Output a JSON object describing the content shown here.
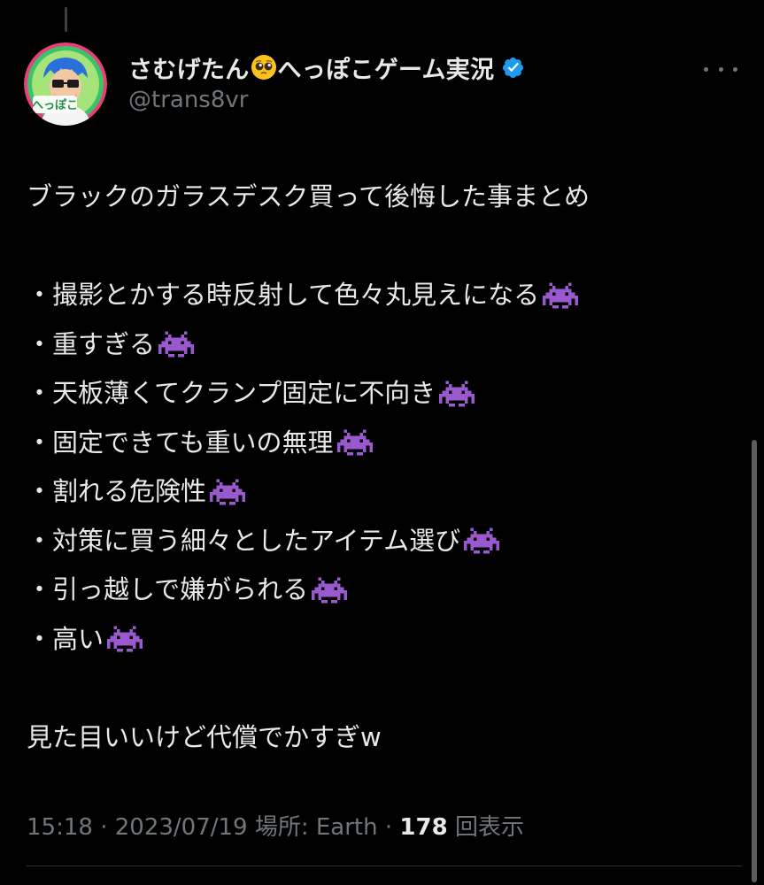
{
  "tweet": {
    "author": {
      "display_name_before_emoji": "さむげたん",
      "display_name_after_emoji": "へっぽこゲーム実況",
      "name_emoji": "pleading-face-emoji",
      "handle": "@trans8vr",
      "verified": true,
      "avatar_text": "へっぽこ"
    },
    "lines": [
      {
        "text": "ブラックのガラスデスク買って後悔した事まとめ",
        "alien": false
      },
      {
        "text": "",
        "alien": false
      },
      {
        "text": "・撮影とかする時反射して色々丸見えになる",
        "alien": true
      },
      {
        "text": "・重すぎる",
        "alien": true
      },
      {
        "text": "・天板薄くてクランプ固定に不向き",
        "alien": true
      },
      {
        "text": "・固定できても重いの無理",
        "alien": true
      },
      {
        "text": "・割れる危険性",
        "alien": true
      },
      {
        "text": "・対策に買う細々としたアイテム選び",
        "alien": true
      },
      {
        "text": "・引っ越しで嫌がられる",
        "alien": true
      },
      {
        "text": "・高い",
        "alien": true
      },
      {
        "text": "",
        "alien": false
      },
      {
        "text": "見た目いいけど代償でかすぎw",
        "alien": false
      }
    ],
    "meta": {
      "time": "15:18",
      "separator": " · ",
      "date": "2023/07/19",
      "location_label": "場所: Earth",
      "views_count": "178",
      "views_label": "回表示"
    }
  },
  "colors": {
    "background": "#000000",
    "text_primary": "#e7e9ea",
    "text_secondary": "#71767b",
    "verified_blue": "#1d9bf0",
    "alien_purple": "#9b59d0",
    "avatar_ring": "#e8417a"
  },
  "icons": {
    "emoji_alien": "alien-monster-emoji",
    "more": "more-options-icon",
    "verified": "verified-badge-icon"
  }
}
